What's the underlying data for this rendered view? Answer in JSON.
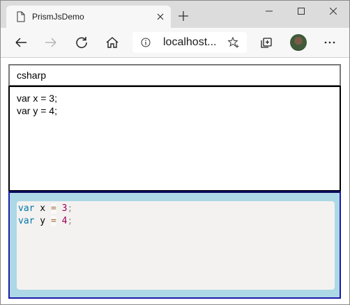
{
  "browser": {
    "tab_title": "PrismJsDemo",
    "address": "localhost...",
    "icons": {
      "page": "page-icon",
      "close": "close-icon",
      "new_tab": "plus-icon",
      "back": "arrow-left-icon",
      "forward": "arrow-right-icon",
      "refresh": "refresh-icon",
      "home": "home-icon",
      "info": "info-icon",
      "favorite": "star-icon",
      "collections": "collections-icon",
      "more": "ellipsis-icon"
    }
  },
  "page": {
    "language_value": "csharp",
    "code_lines": [
      "var x = 3;",
      "var y = 4;"
    ],
    "highlighted": [
      {
        "kw": "var",
        "ident": " x ",
        "op": "=",
        "num": "3",
        "pun": ";"
      },
      {
        "kw": "var",
        "ident": " y ",
        "op": "=",
        "num": "4",
        "pun": ";"
      }
    ]
  },
  "colors": {
    "preview_bg": "#add8e6",
    "code_bg": "#f4f2f0",
    "keyword": "#0077aa",
    "number": "#990055"
  }
}
